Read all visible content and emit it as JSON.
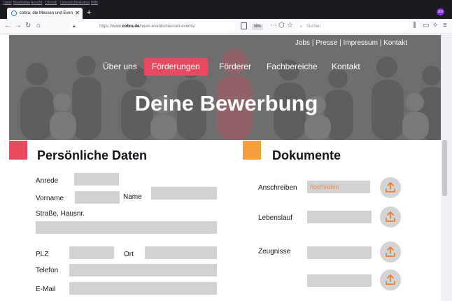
{
  "browser": {
    "menu": [
      "Datei",
      "Bearbeiten",
      "Ansicht",
      "Chronik",
      "Lesezeichen",
      "Extras",
      "Hilfe"
    ],
    "tab_title": "cobra: die Messen und Events",
    "new_tab": "+",
    "url_prefix": "https://www.",
    "url_domain": "cobra.de",
    "url_path": "/news-events/messen-events/",
    "zoom": "90%",
    "search_placeholder": "Suchen",
    "extension_badge": "oo"
  },
  "site": {
    "top_links": "Jobs  |  Presse | Impressum | Kontakt",
    "nav": [
      "Über uns",
      "Förderungen",
      "Förderer",
      "Fachbereiche",
      "Kontakt"
    ],
    "active_nav": "Förderungen",
    "hero_title": "Deine Bewerbung"
  },
  "form": {
    "personal_title": "Persönliche Daten",
    "labels": {
      "anrede": "Anrede",
      "vorname": "Vorname",
      "name": "Name",
      "strasse": "Straße, Hausnr.",
      "plz": "PLZ",
      "ort": "Ort",
      "telefon": "Telefon",
      "email": "E-Mail"
    },
    "documents_title": "Dokumente",
    "documents": {
      "anschreiben": "Anschreiben",
      "anschreiben_placeholder": "hochladen",
      "lebenslauf": "Lebenslauf",
      "zeugnisse": "Zeugnisse"
    }
  },
  "colors": {
    "accent_pink": "#e9485f",
    "accent_orange": "#f5a03c",
    "upload_arrow": "#f07c2c",
    "field_gray": "#d2d2d4"
  },
  "icons": {
    "upload": "upload-arrow-icon",
    "back": "arrow-left-icon",
    "forward": "arrow-right-icon",
    "reload": "reload-icon",
    "home": "home-icon"
  }
}
